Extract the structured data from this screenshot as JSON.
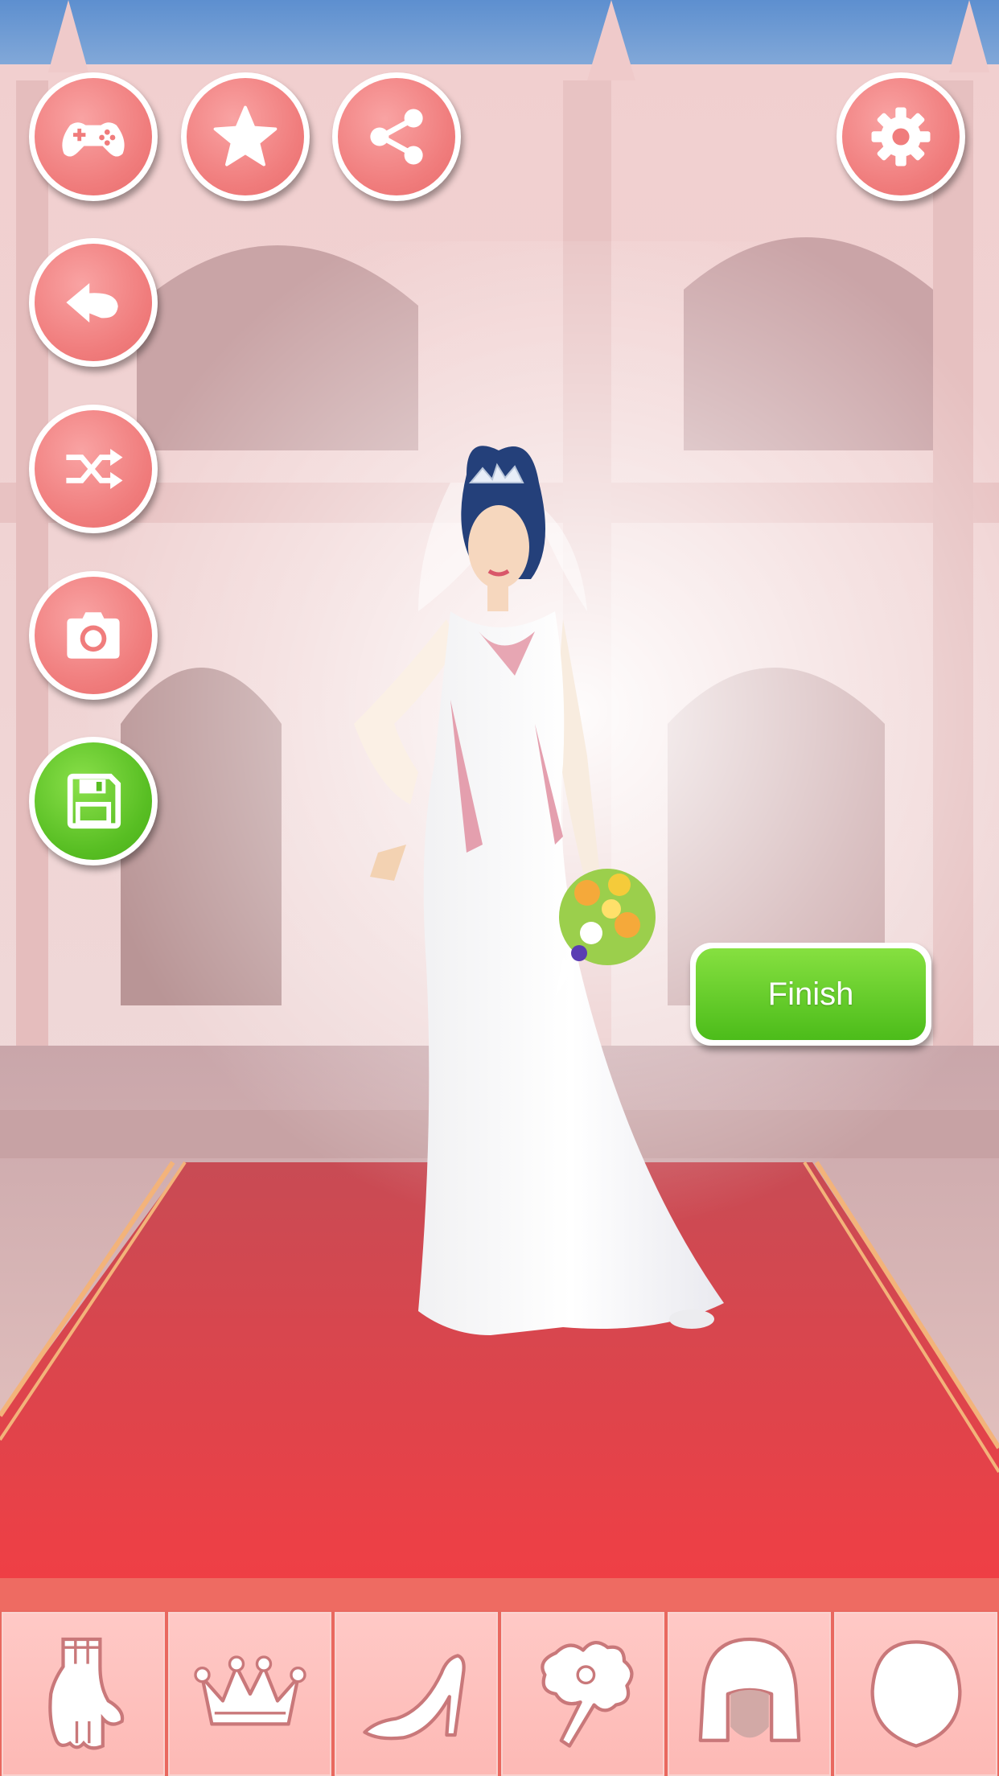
{
  "toolbar": {
    "game_button_icon": "gamepad-icon",
    "favorite_button_icon": "star-icon",
    "share_button_icon": "share-icon",
    "settings_button_icon": "gear-icon",
    "back_button_icon": "back-arrow-icon",
    "shuffle_button_icon": "shuffle-icon",
    "camera_button_icon": "camera-icon",
    "save_button_icon": "floppy-disk-icon"
  },
  "finish_button": {
    "label": "Finish"
  },
  "categories": [
    {
      "name": "gloves",
      "icon": "glove-icon"
    },
    {
      "name": "crown",
      "icon": "crown-icon"
    },
    {
      "name": "shoes",
      "icon": "high-heel-icon"
    },
    {
      "name": "bouquet",
      "icon": "flower-bouquet-icon"
    },
    {
      "name": "hair",
      "icon": "hair-icon"
    },
    {
      "name": "face",
      "icon": "face-icon"
    }
  ],
  "colors": {
    "button_pink": "#f07c7c",
    "button_green": "#58be23",
    "carpet_red": "#ef3f45",
    "tray": "#e9685f"
  }
}
